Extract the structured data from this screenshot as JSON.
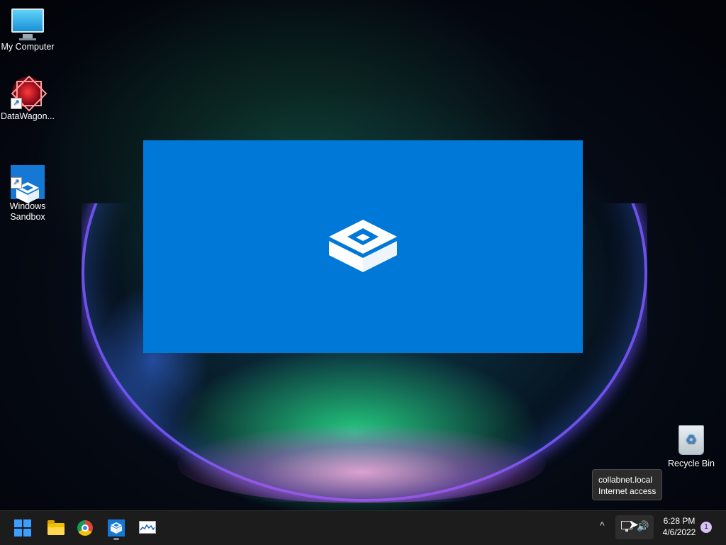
{
  "desktop": {
    "icons": [
      {
        "label": "My Computer",
        "icon": "computer-icon"
      },
      {
        "label": "DataWagon...",
        "icon": "datawagon-icon"
      },
      {
        "label": "Windows\nSandbox",
        "icon": "windows-sandbox-icon"
      },
      {
        "label": "Recycle Bin",
        "icon": "recycle-bin-icon"
      }
    ]
  },
  "sandbox_window": {
    "icon": "windows-sandbox-logo",
    "background": "#0078d7"
  },
  "tooltip": {
    "line1": "collabnet.local",
    "line2": "Internet access"
  },
  "taskbar": {
    "apps": [
      {
        "name": "start",
        "icon": "windows-start-icon"
      },
      {
        "name": "file-explorer",
        "icon": "folder-icon"
      },
      {
        "name": "chrome",
        "icon": "chrome-icon"
      },
      {
        "name": "windows-sandbox",
        "icon": "windows-sandbox-icon",
        "active": true
      },
      {
        "name": "resource-monitor",
        "icon": "monitor-chart-icon"
      }
    ],
    "tray": {
      "chevron": "^",
      "volume": "🔊",
      "time": "6:28 PM",
      "date": "4/6/2022",
      "notification_count": "1"
    }
  },
  "colors": {
    "accent": "#0078d7",
    "taskbar": "#1c1c1c"
  }
}
